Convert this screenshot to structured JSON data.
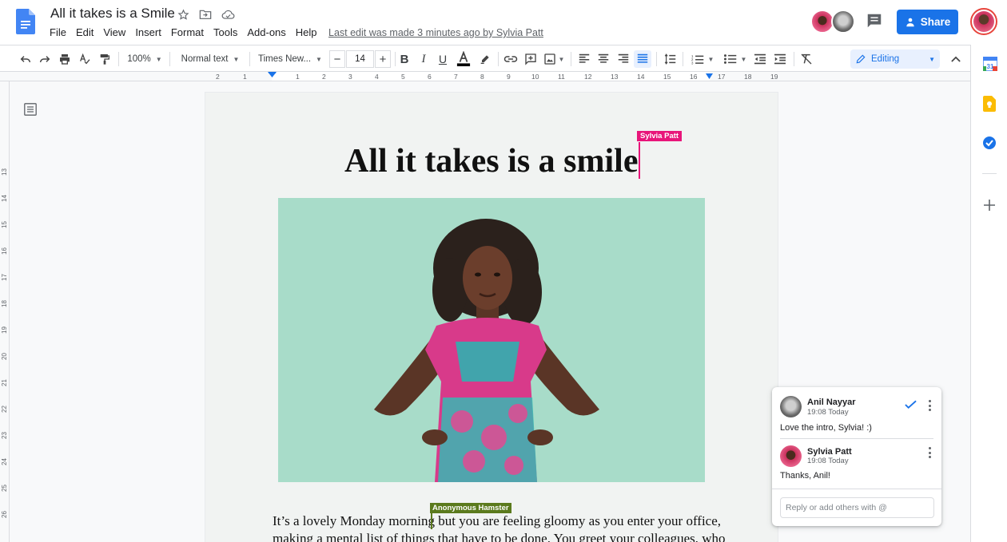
{
  "header": {
    "title": "All it takes is a Smile",
    "last_edit": "Last edit was made 3 minutes ago by Sylvia Patt",
    "share_label": "Share",
    "menu": [
      "File",
      "Edit",
      "View",
      "Insert",
      "Format",
      "Tools",
      "Add-ons",
      "Help"
    ]
  },
  "toolbar": {
    "zoom": "100%",
    "style": "Normal text",
    "font": "Times New...",
    "font_size": "14",
    "mode": "Editing"
  },
  "ruler": {
    "h_ticks": [
      "2",
      "1",
      "1",
      "2",
      "3",
      "4",
      "5",
      "6",
      "7",
      "8",
      "9",
      "10",
      "11",
      "12",
      "13",
      "14",
      "15",
      "16",
      "17",
      "18",
      "19"
    ],
    "v_ticks": [
      "13",
      "14",
      "15",
      "16",
      "17",
      "18",
      "19",
      "20",
      "21",
      "22",
      "23",
      "24",
      "25",
      "26"
    ]
  },
  "document": {
    "title": "All it takes is a smile",
    "cursor_sylvia": "Sylvia Patt",
    "cursor_anon": "Anonymous Hamster",
    "line1_before": "It’s a lovely Monday morning",
    "line1_after": " but you are feeling gloomy as you enter your office,",
    "line2": "making a mental list of things that have to be done. You greet your colleagues, who"
  },
  "comments": {
    "c1": {
      "name": "Anil Nayyar",
      "time": "19:08 Today",
      "text": "Love the intro, Sylvia! :)"
    },
    "c2": {
      "name": "Sylvia Patt",
      "time": "19:08 Today",
      "text": "Thanks, Anil!"
    },
    "reply_placeholder": "Reply or add others with @"
  },
  "colors": {
    "accent": "#1a73e8",
    "sylvia_cursor": "#e8157a",
    "anon_cursor": "#5b7a1d",
    "photo_bg": "#a8dcc9"
  },
  "icons": [
    "docs-logo-icon",
    "star-icon",
    "move-folder-icon",
    "cloud-icon",
    "comment-history-icon",
    "share-people-icon",
    "undo-icon",
    "redo-icon",
    "print-icon",
    "spellcheck-icon",
    "paint-format-icon",
    "bold-icon",
    "italic-icon",
    "underline-icon",
    "text-color-icon",
    "highlight-icon",
    "link-icon",
    "add-comment-icon",
    "insert-image-icon",
    "align-left-icon",
    "align-center-icon",
    "align-right-icon",
    "justify-icon",
    "line-spacing-icon",
    "numbered-list-icon",
    "bulleted-list-icon",
    "decrease-indent-icon",
    "increase-indent-icon",
    "clear-formatting-icon",
    "pencil-icon",
    "collapse-icon",
    "outline-icon",
    "resolve-check-icon",
    "more-options-icon",
    "calendar-icon",
    "keep-icon",
    "tasks-icon",
    "plus-icon"
  ]
}
